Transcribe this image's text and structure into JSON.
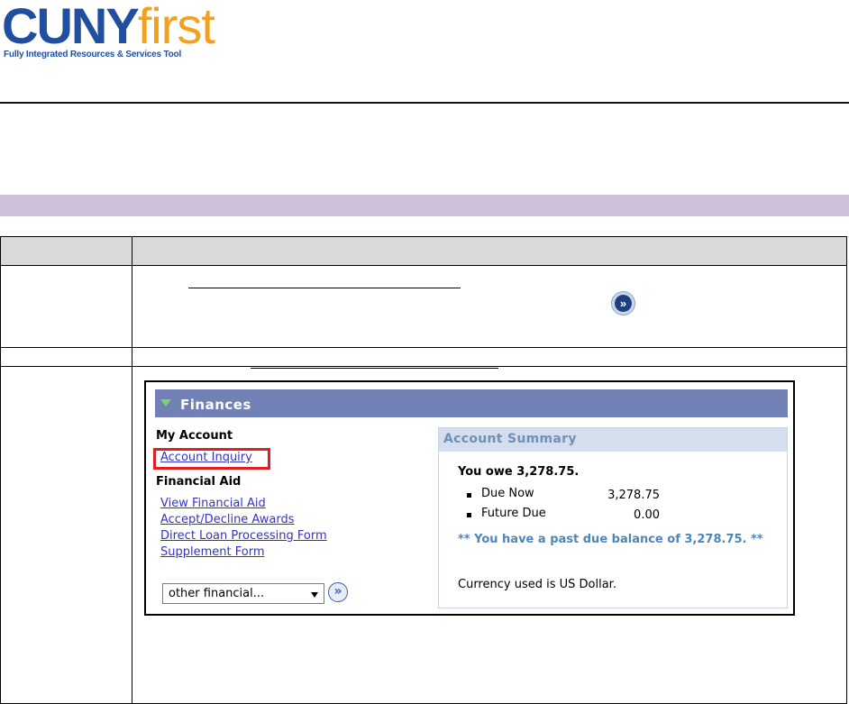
{
  "logo": {
    "cuny": "CUNY",
    "first": "first",
    "tagline": "Fully Integrated Resources & Services Tool"
  },
  "finances_panel": {
    "title": "Finances",
    "my_account_heading": "My Account",
    "account_inquiry_link": "Account Inquiry",
    "financial_aid_heading": "Financial Aid",
    "links": [
      "View Financial Aid",
      "Accept/Decline Awards",
      "Direct Loan Processing Form",
      "Supplement Form"
    ],
    "dropdown_value": "other financial...",
    "go_button": "»"
  },
  "account_summary": {
    "title": "Account Summary",
    "owe_text": "You owe 3,278.75.",
    "items": [
      {
        "label": "Due Now",
        "value": "3,278.75"
      },
      {
        "label": "Future Due",
        "value": "0.00"
      }
    ],
    "past_due_text": "** You have a past due balance of 3,278.75. **",
    "currency_text": "Currency used is US Dollar."
  },
  "colors": {
    "logo_blue": "#1f4f9e",
    "logo_orange": "#f3a11c",
    "band": "#ccc0da",
    "finances_header": "#7181b6",
    "link": "#3333cc",
    "highlight": "#e02020",
    "past_due": "#4f86b8"
  }
}
